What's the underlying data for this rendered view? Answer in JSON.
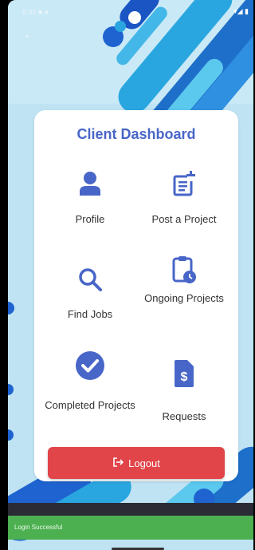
{
  "status_bar": {
    "left": "9:41 ■ ●",
    "right": "▾◢ ▮"
  },
  "dashboard": {
    "title": "Client Dashboard",
    "tiles": [
      {
        "label": "Profile",
        "icon": "person-icon"
      },
      {
        "label": "Post a Project",
        "icon": "post-add-icon"
      },
      {
        "label": "Find Jobs",
        "icon": "search-icon"
      },
      {
        "label": "Ongoing Projects",
        "icon": "pending-actions-icon"
      },
      {
        "label": "Completed Projects",
        "icon": "check-circle-icon"
      },
      {
        "label": "Requests",
        "icon": "request-document-icon"
      }
    ],
    "logout_label": "Logout"
  },
  "snackbar": {
    "message": "Login Successful"
  },
  "colors": {
    "accent": "#4866c8",
    "logout": "#e14449",
    "snackbar": "#4caf50",
    "background": "#bfe3f3"
  }
}
